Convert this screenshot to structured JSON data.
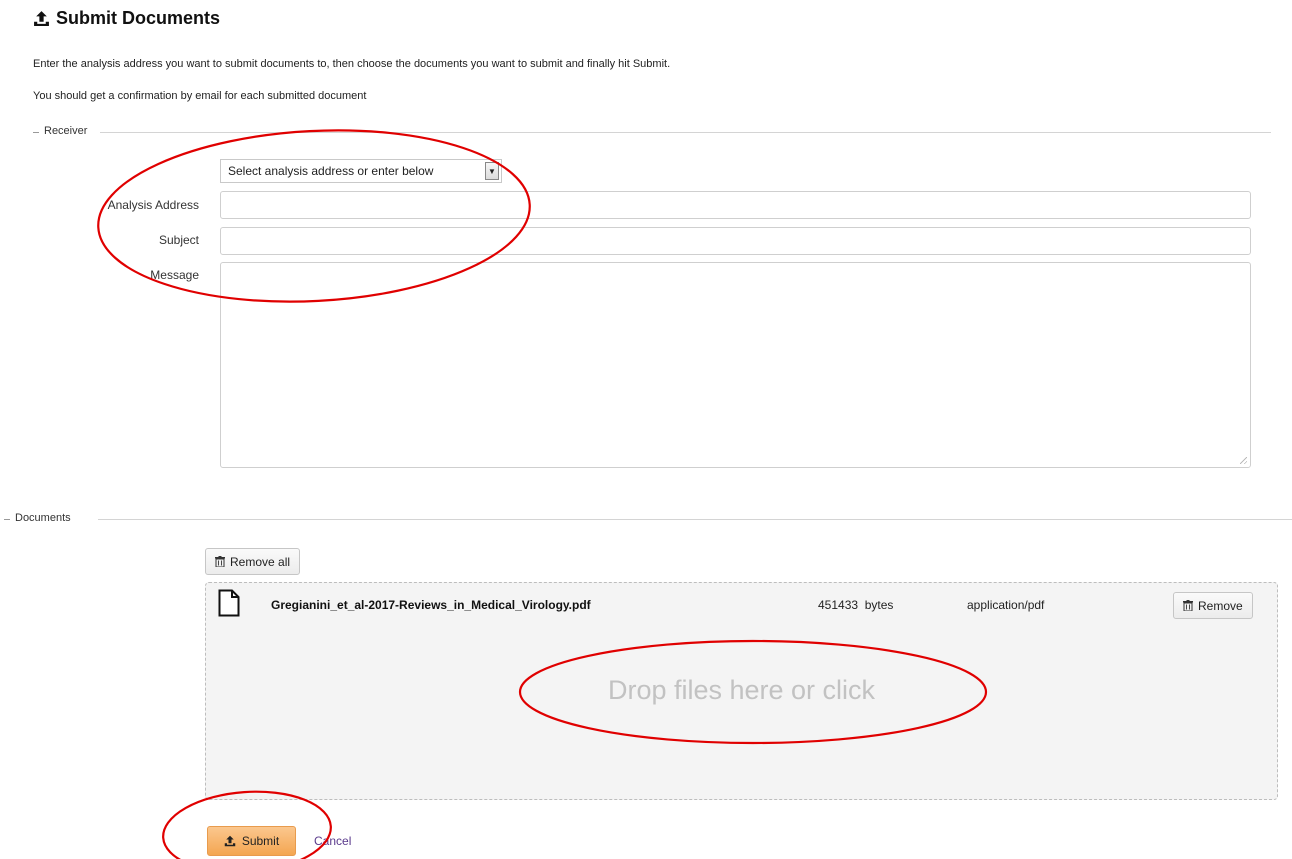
{
  "header": {
    "title": "Submit Documents",
    "icon": "upload-icon"
  },
  "intro": {
    "line1": "Enter the analysis address you want to submit documents to, then choose the documents you want to submit and finally hit Submit.",
    "line2": "You should get a confirmation by email for each submitted document"
  },
  "receiver": {
    "legend": "Receiver",
    "select": {
      "selected": "Select analysis address or enter below"
    },
    "fields": {
      "analysis_address_label": "Analysis Address",
      "analysis_address_value": "",
      "subject_label": "Subject",
      "subject_value": "",
      "message_label": "Message",
      "message_value": ""
    }
  },
  "documents": {
    "legend": "Documents",
    "remove_all_label": "Remove all",
    "files": [
      {
        "name": "Gregianini_et_al-2017-Reviews_in_Medical_Virology.pdf",
        "size": "451433  bytes",
        "type": "application/pdf",
        "remove_label": "Remove"
      }
    ],
    "drop_hint": "Drop files here or click"
  },
  "actions": {
    "submit_label": "Submit",
    "cancel_label": "Cancel"
  },
  "colors": {
    "submit_bg": "#f4a651",
    "annotation": "#e00000",
    "link": "#5a3a8c"
  }
}
